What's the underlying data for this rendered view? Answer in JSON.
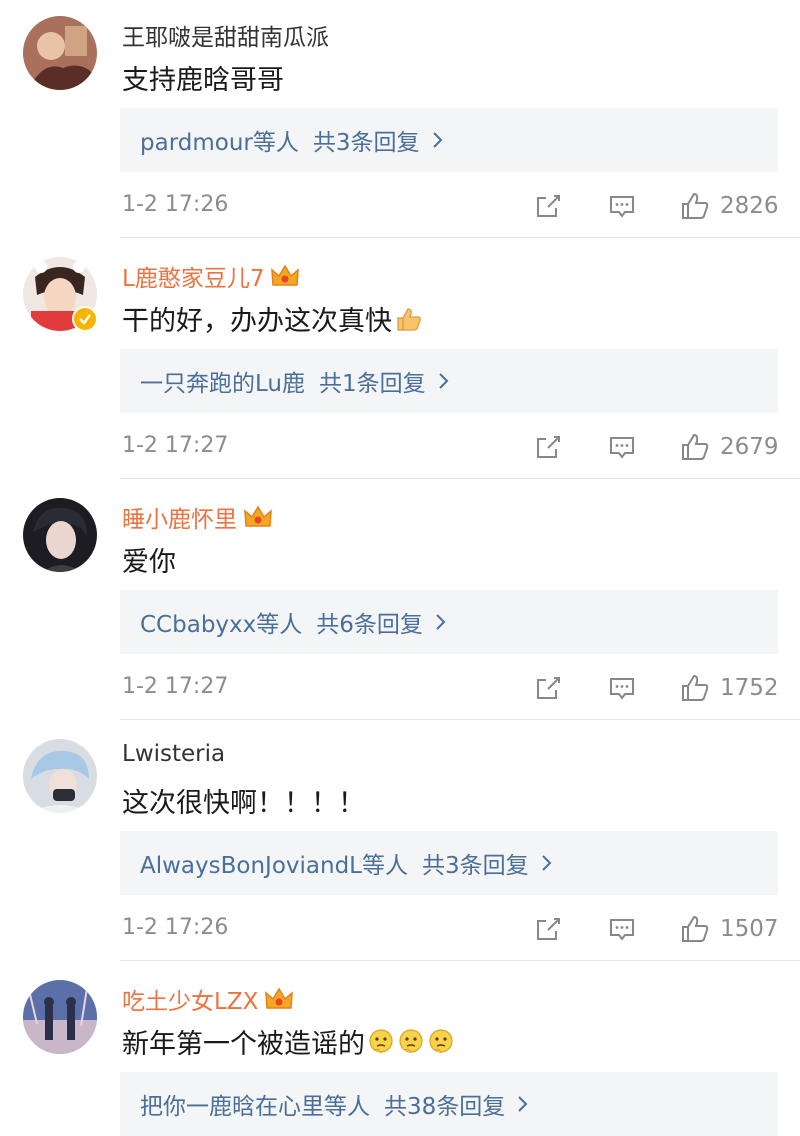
{
  "comments": [
    {
      "username": "王耶啵是甜甜南瓜派",
      "text": "支持鹿晗哥哥",
      "reply_summary": {
        "who": "pardmour等人",
        "count": "共3条回复"
      },
      "time": "1-2 17:26",
      "likes": "2826"
    },
    {
      "username": "L鹿憨家豆儿7",
      "text": "干的好，办办这次真快",
      "reply_summary": {
        "who": "一只奔跑的Lu鹿",
        "count": "共1条回复"
      },
      "time": "1-2 17:27",
      "likes": "2679"
    },
    {
      "username": "睡小鹿怀里",
      "text": "爱你",
      "reply_summary": {
        "who": "CCbabyxx等人",
        "count": "共6条回复"
      },
      "time": "1-2 17:27",
      "likes": "1752"
    },
    {
      "username": "Lwisteria",
      "text": "这次很快啊！！！！",
      "reply_summary": {
        "who": "AlwaysBonJoviandL等人",
        "count": "共3条回复"
      },
      "time": "1-2 17:26",
      "likes": "1507"
    },
    {
      "username": "吃土少女LZX",
      "text": "新年第一个被造谣的",
      "reply_summary": {
        "who": "把你一鹿晗在心里等人",
        "count": "共38条回复"
      }
    }
  ],
  "colors": {
    "vip_name": "#eb7340",
    "link": "#4a6f9a",
    "meta": "#8c8c8c",
    "reply_bg": "#f4f5f7",
    "divider": "#e6e6e6"
  },
  "icons": [
    "share-icon",
    "comment-icon",
    "like-icon",
    "crown-icon",
    "verified-icon",
    "chevron-right-icon",
    "thumbs-up-emoji",
    "thinking-emoji"
  ]
}
